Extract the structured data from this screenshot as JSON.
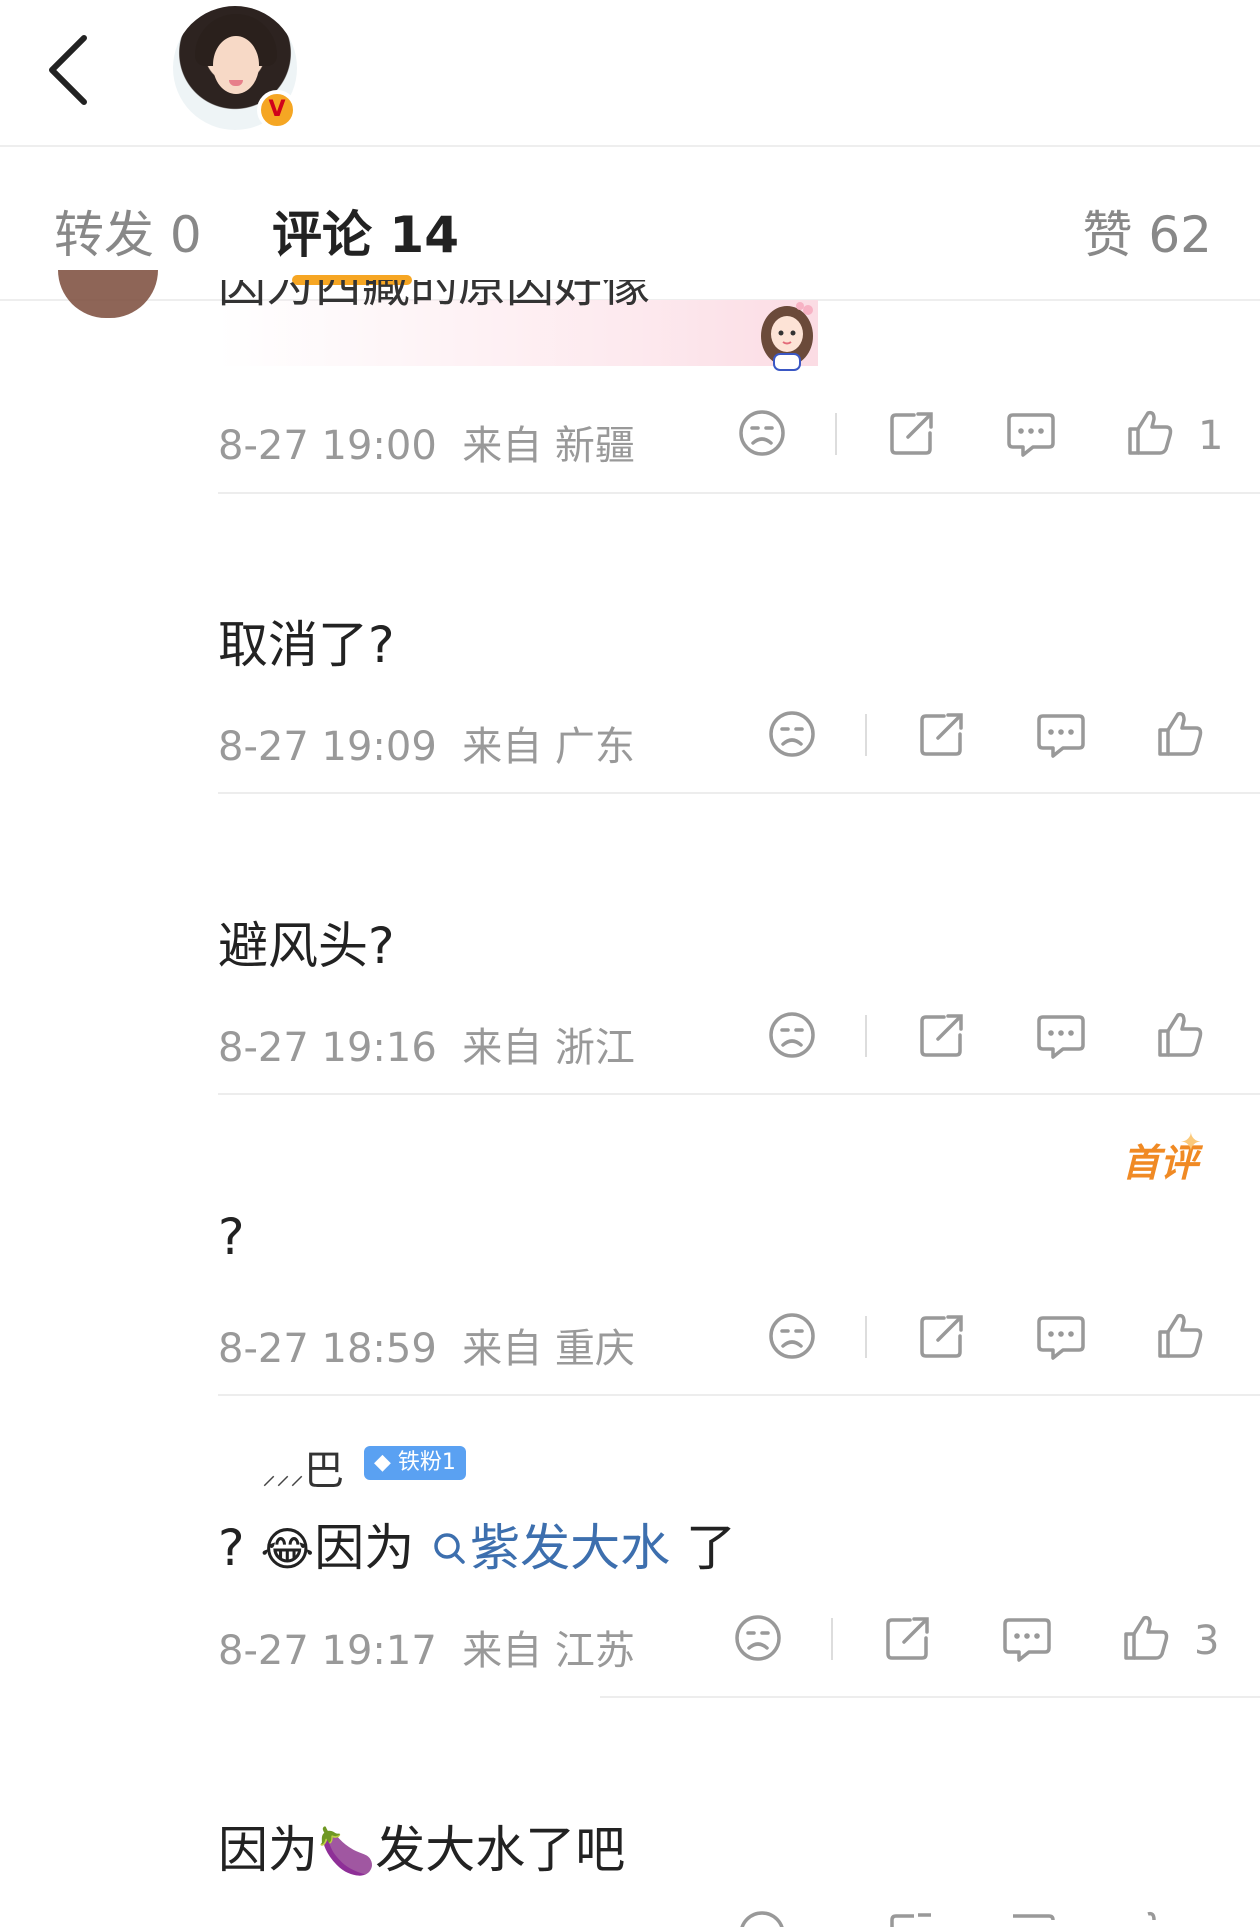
{
  "header": {
    "back_icon": "chevron-left-icon",
    "verified_badge": "V"
  },
  "tabs": {
    "repost": "转发 0",
    "comment": "评论 14",
    "like": "赞 62"
  },
  "colors": {
    "accent": "#f6a623",
    "meta": "#999999",
    "topic_link": "#3d6fae",
    "first_badge": "#f08a24"
  },
  "comments": [
    {
      "text": "因为西藏的原因好像",
      "time": "8-27 19:00",
      "location": "来自 新疆",
      "likes": "1"
    },
    {
      "text": "取消了?",
      "time": "8-27 19:09",
      "location": "来自 广东",
      "likes": ""
    },
    {
      "text": "避风头?",
      "time": "8-27 19:16",
      "location": "来自 浙江",
      "likes": ""
    },
    {
      "badge": "首评",
      "text": "?",
      "time": "8-27 18:59",
      "location": "来自 重庆",
      "likes": ""
    },
    {
      "author": "巴",
      "fan_badge": "铁粉1",
      "text_prefix": "?",
      "emoji": "😂",
      "text_mid": "因为",
      "topic": "紫发大水",
      "text_suffix": "了",
      "time": "8-27 19:17",
      "location": "来自 江苏",
      "likes": "3"
    },
    {
      "text_prefix": "因为",
      "emoji": "🍆",
      "text_suffix": "发大水了吧"
    }
  ]
}
